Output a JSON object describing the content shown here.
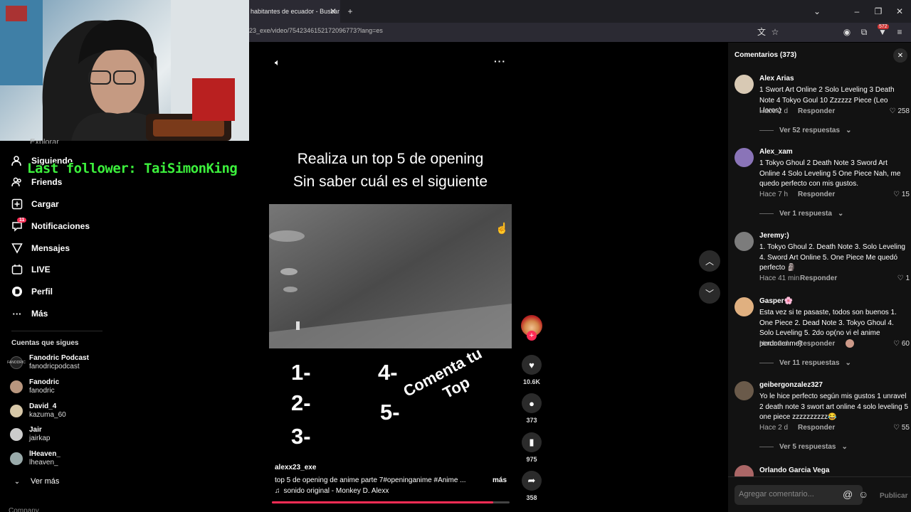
{
  "browser": {
    "tab_title": "habitantes de ecuador - Buscar",
    "url": "23_exe/video/7542346152172096773?lang=es",
    "badge": "572"
  },
  "overlay": {
    "last_follower": "Last follower: TaiSimonKing"
  },
  "sidebar": {
    "items": [
      {
        "label": "Siguiendo",
        "icon": "following-icon"
      },
      {
        "label": "Friends",
        "icon": "friends-icon"
      },
      {
        "label": "Cargar",
        "icon": "upload-icon"
      },
      {
        "label": "Notificaciones",
        "icon": "notifications-icon",
        "badge": "11"
      },
      {
        "label": "Mensajes",
        "icon": "messages-icon"
      },
      {
        "label": "LIVE",
        "icon": "live-icon"
      },
      {
        "label": "Perfil",
        "icon": "profile-icon"
      },
      {
        "label": "Más",
        "icon": "more-icon"
      }
    ],
    "following_header": "Cuentas que sigues",
    "following": [
      {
        "name": "Fanodric Podcast",
        "handle": "fanodricpodcast"
      },
      {
        "name": "Fanodric",
        "handle": "fanodric"
      },
      {
        "name": "David_4",
        "handle": "kazuma_60"
      },
      {
        "name": "Jair",
        "handle": "jairkap"
      },
      {
        "name": "lHeaven_",
        "handle": "lheaven_"
      }
    ],
    "see_more": "Ver más",
    "company": "Company"
  },
  "video": {
    "title_line1": "Realiza un top 5 de opening",
    "title_line2": "Sin saber cuál es el siguiente",
    "numbers_left": [
      "1-",
      "2-",
      "3-"
    ],
    "numbers_right": [
      "4-",
      "5-"
    ],
    "overlay_text_line1": "Comenta tu",
    "overlay_text_line2": "Top",
    "author": "alexx23_exe",
    "description": "top 5 de opening de anime parte 7#openinganime  #Anime ...",
    "more": "más",
    "sound": "sonido original - Monkey D. Alexx",
    "progress": 0.93
  },
  "actions": {
    "likes": "10.6K",
    "comments": "373",
    "saves": "975",
    "shares": "358"
  },
  "comments_panel": {
    "title": "Comentarios (373)",
    "input_placeholder": "Agregar comentario...",
    "publish": "Publicar",
    "reply_label": "Responder",
    "items": [
      {
        "user": "Alex Arias",
        "text": "1 Swort Art Online 2 Solo Leveling 3 Death Note 4 Tokyo Goul 10 Zzzzzz Piece (Leo Lloros)",
        "time": "Hace 2 d",
        "likes": "258",
        "more": "Ver 52 respuestas"
      },
      {
        "user": "Alex_xam",
        "text": "1 Tokyo Ghoul 2 Death Note 3 Sword Art Online 4 Solo Leveling 5 One Piece Nah, me quedo perfecto con mis gustos.",
        "time": "Hace 7 h",
        "likes": "15",
        "more": "Ver 1 respuesta"
      },
      {
        "user": "Jeremy:)",
        "text": "1. Tokyo Ghoul 2. Death Note 3. Solo Leveling 4. Sword Art Online 5. One Piece Me quedó perfecto 🗿",
        "time": "Hace 41 min",
        "likes": "1",
        "more": ""
      },
      {
        "user": "Gasper🌸",
        "text": "Esta vez si te pasaste, todos son buenos 1. One Piece 2. Dead Note 3. Tokyo Ghoul 4. Solo Leveling 5. 2do op(no vi el anime perdonenme)",
        "time": "Hace 2 d",
        "likes": "60",
        "more": "Ver 11 respuestas"
      },
      {
        "user": "geibergonzalez327",
        "text": "Yo le hice perfecto según mis gustos 1 unravel 2 death note 3 swort art online 4 solo leveling 5 one piece zzzzzzzzzz😂",
        "time": "Hace 2 d",
        "likes": "55",
        "more": "Ver 5 respuestas"
      },
      {
        "user": "Orlando Garcia Vega",
        "text": "",
        "time": "",
        "likes": "",
        "more": ""
      }
    ]
  }
}
